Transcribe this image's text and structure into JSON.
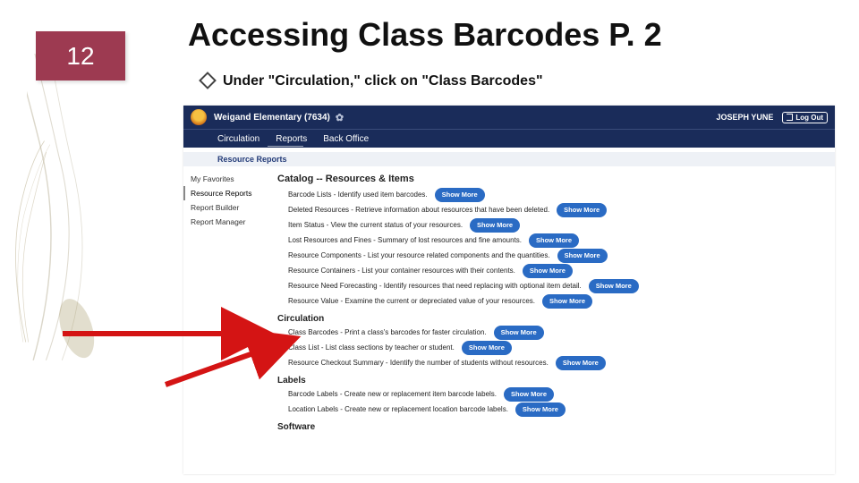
{
  "slide": {
    "page_number": "12",
    "title": "Accessing Class Barcodes P. 2",
    "bullet_text": "Under \"Circulation,\" click on \"Class Barcodes\""
  },
  "screenshot": {
    "topbar": {
      "school_name": "Weigand Elementary (7634)",
      "user": "JOSEPH YUNE",
      "logout_label": "Log Out"
    },
    "nav": [
      "Circulation",
      "Reports",
      "Back Office"
    ],
    "breadcrumb": "Resource Reports",
    "sidebar": [
      "My Favorites",
      "Resource Reports",
      "Report Builder",
      "Report Manager"
    ],
    "section_title": "Catalog -- Resources & Items",
    "catalog_rows": [
      "Barcode Lists - Identify used item barcodes.",
      "Deleted Resources - Retrieve information about resources that have been deleted.",
      "Item Status - View the current status of your resources.",
      "Lost Resources and Fines - Summary of lost resources and fine amounts.",
      "Resource Components - List your resource related components and the quantities.",
      "Resource Containers - List your container resources with their contents.",
      "Resource Need Forecasting - Identify resources that need replacing with optional item detail.",
      "Resource Value - Examine the current or depreciated value of your resources."
    ],
    "circulation_title": "Circulation",
    "circulation_rows": [
      "Class Barcodes - Print a class's barcodes for faster circulation.",
      "Class List - List class sections by teacher or student.",
      "Resource Checkout Summary - Identify the number of students without resources."
    ],
    "labels_title": "Labels",
    "labels_rows": [
      "Barcode Labels - Create new or replacement item barcode labels.",
      "Location Labels - Create new or replacement location barcode labels."
    ],
    "software_title": "Software",
    "show_more_label": "Show More"
  }
}
